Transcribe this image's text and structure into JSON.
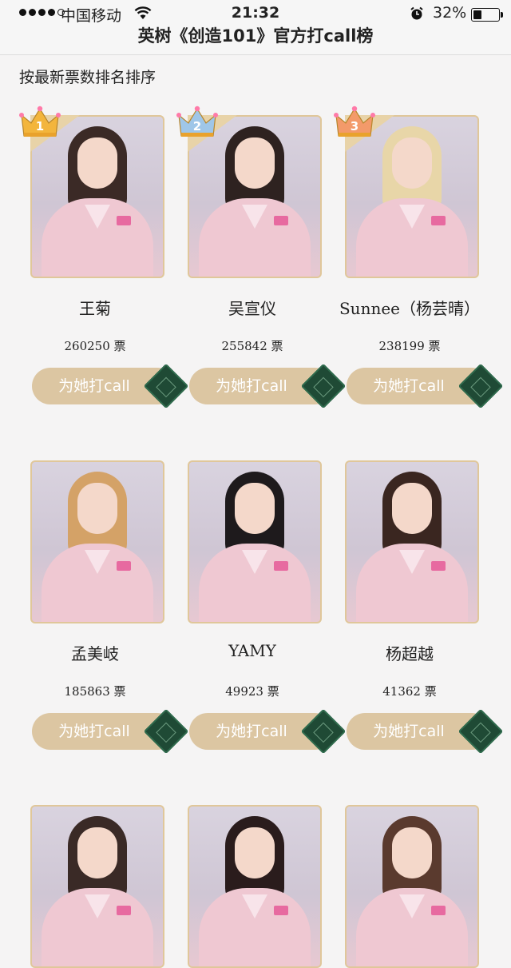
{
  "status_bar": {
    "carrier": "中国移动",
    "time": "21:32",
    "battery": "32%"
  },
  "nav": {
    "title": "英树《创造101》官方打call榜"
  },
  "subtitle": "按最新票数排名排序",
  "call_button_label": "为她打call",
  "contestants": [
    {
      "name": "王菊",
      "votes": "260250 票",
      "rank": 1,
      "hair": "#3b2a26"
    },
    {
      "name": "吴宣仪",
      "votes": "255842 票",
      "rank": 2,
      "hair": "#2e2220"
    },
    {
      "name": "Sunnee（杨芸晴）",
      "votes": "238199 票",
      "rank": 3,
      "hair": "#e8d6a8"
    },
    {
      "name": "孟美岐",
      "votes": "185863 票",
      "hair": "#d4a267"
    },
    {
      "name": "YAMY",
      "votes": "49923 票",
      "hair": "#1e1a1c"
    },
    {
      "name": "杨超越",
      "votes": "41362 票",
      "hair": "#3a2620"
    },
    {
      "name": "",
      "votes": "",
      "hair": "#3a2a26"
    },
    {
      "name": "",
      "votes": "",
      "hair": "#2a1c1c"
    },
    {
      "name": "",
      "votes": "",
      "hair": "#5a3a2e"
    }
  ]
}
